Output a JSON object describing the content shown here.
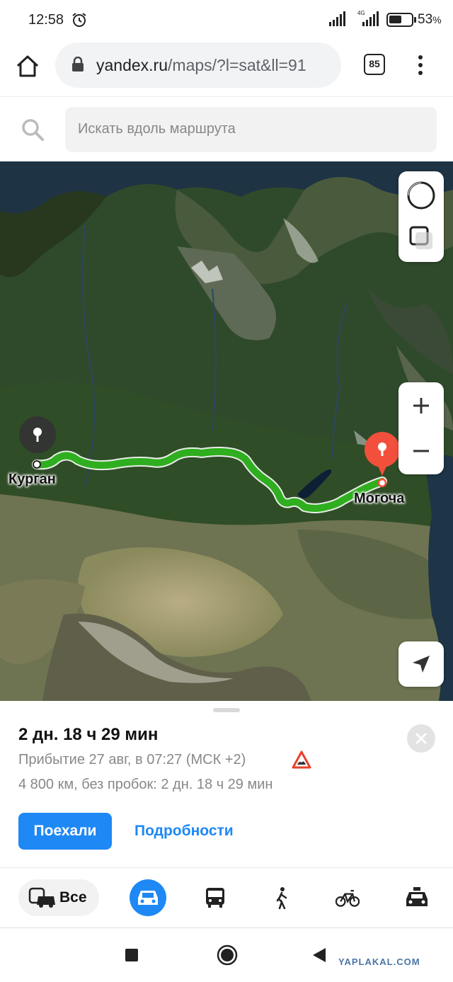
{
  "status": {
    "time": "12:58",
    "network": "4G",
    "battery_percent": "53",
    "battery_suffix": "%"
  },
  "browser": {
    "url_domain": "yandex.ru",
    "url_rest": "/maps/?l=sat&ll=91",
    "tab_count": "85"
  },
  "search": {
    "placeholder": "Искать вдоль маршрута"
  },
  "map": {
    "origin": "Курган",
    "destination": "Могоча",
    "route_color": "#2fae1f",
    "destination_pin_color": "#f2503c"
  },
  "route": {
    "duration": "2 дн. 18 ч 29 мин",
    "arrival": "Прибытие 27 авг, в 07:27 (МСК +2)",
    "distance": "4 800 км, без пробок: 2 дн. 18 ч 29 мин",
    "go_label": "Поехали",
    "details_label": "Подробности"
  },
  "modes": {
    "all_label": "Все",
    "active_mode": "car",
    "accent": "#1e88f5"
  },
  "watermark": "YAPLAKAL.COM"
}
